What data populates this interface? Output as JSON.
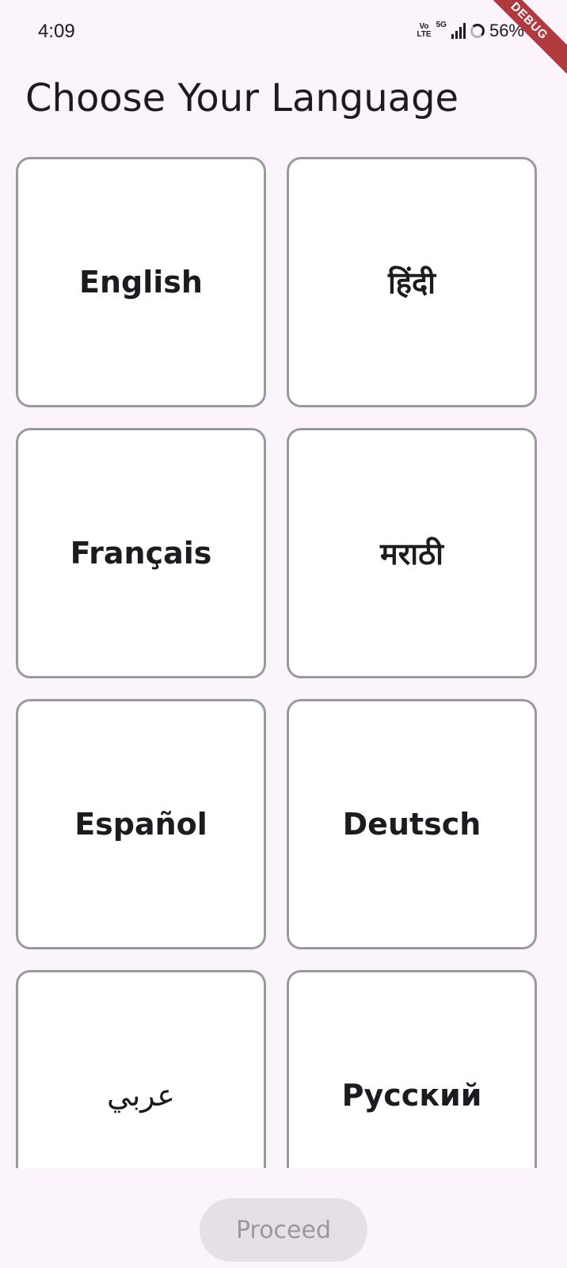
{
  "status_bar": {
    "time": "4:09",
    "volte_top": "Vo",
    "volte_bottom": "LTE",
    "network": "5G",
    "battery": "56%",
    "debug_banner": "DEBUG"
  },
  "page": {
    "title": "Choose Your Language"
  },
  "languages": [
    {
      "label": "English"
    },
    {
      "label": "हिंदी"
    },
    {
      "label": "Français"
    },
    {
      "label": "मराठी"
    },
    {
      "label": "Español"
    },
    {
      "label": "Deutsch"
    },
    {
      "label": "عربي"
    },
    {
      "label": "Русский"
    }
  ],
  "actions": {
    "proceed_label": "Proceed",
    "proceed_enabled": false
  },
  "colors": {
    "background": "#fcf4fd",
    "card_border": "#9a999c",
    "button_disabled_bg": "#e5e0e6",
    "button_disabled_text": "#9b979d",
    "debug_ribbon": "#b13a3f"
  }
}
